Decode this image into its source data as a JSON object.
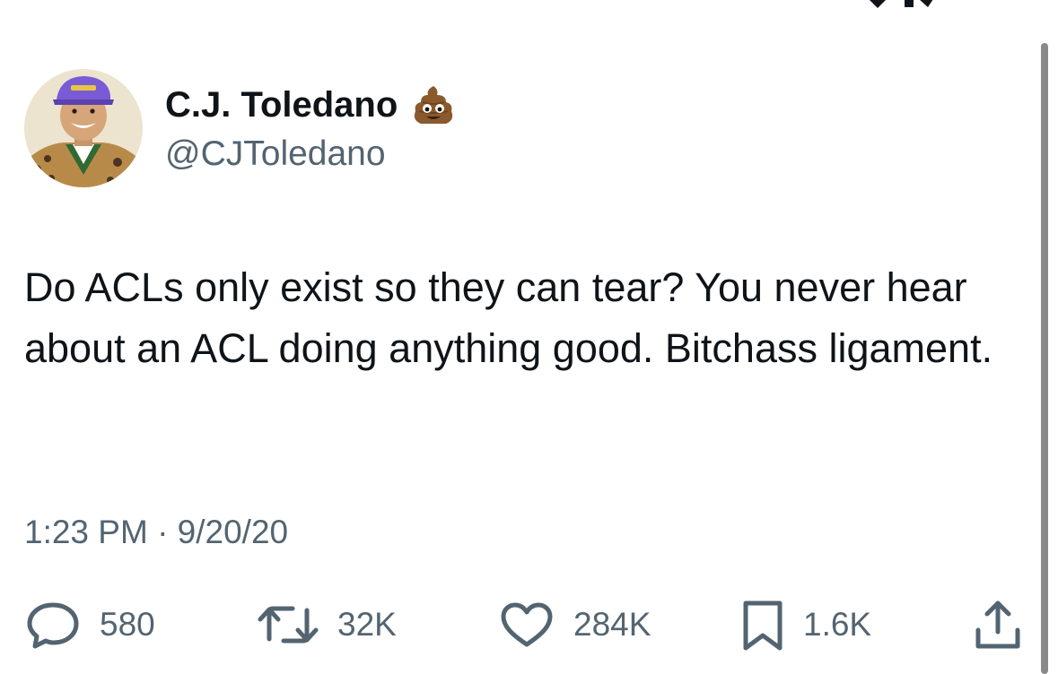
{
  "tweet": {
    "author": {
      "display_name": "C.J. Toledano",
      "handle": "@CJToledano",
      "name_emoji": "pile-of-poo-icon"
    },
    "text": "Do ACLs only exist so they can tear? You never hear about an ACL doing anything good. Bitchass ligament.",
    "timestamp": "1:23 PM · 9/20/20",
    "stats": {
      "replies": "580",
      "retweets": "32K",
      "likes": "284K",
      "bookmarks": "1.6K"
    }
  },
  "icons": {
    "reply": "reply-icon",
    "retweet": "retweet-icon",
    "like": "heart-icon",
    "bookmark": "bookmark-icon",
    "share": "share-icon"
  },
  "colors": {
    "text_primary": "#0f1419",
    "text_secondary": "#536471",
    "background": "#ffffff"
  }
}
